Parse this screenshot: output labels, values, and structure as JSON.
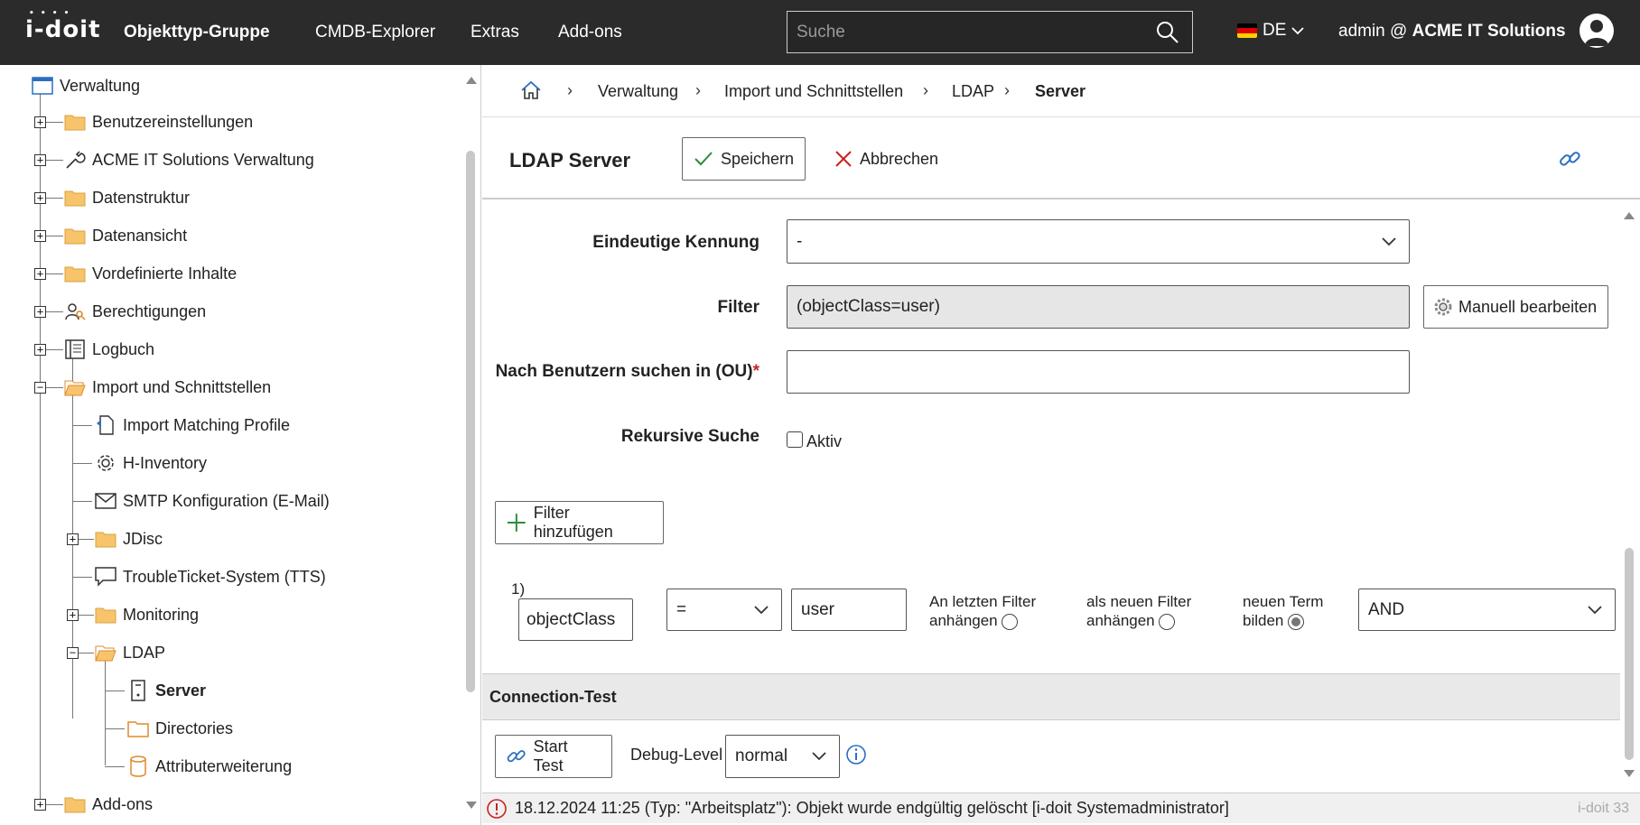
{
  "topbar": {
    "logo": "i-doit",
    "nav": [
      "Objekttyp-Gruppe",
      "CMDB-Explorer",
      "Extras",
      "Add-ons"
    ],
    "search_placeholder": "Suche",
    "language": "DE",
    "user_prefix": "admin @",
    "tenant": "ACME IT Solutions"
  },
  "tree": {
    "root": "Verwaltung",
    "items": [
      {
        "label": "Benutzereinstellungen",
        "icon": "folder-icon"
      },
      {
        "label": "ACME IT Solutions Verwaltung",
        "icon": "wrench-icon"
      },
      {
        "label": "Datenstruktur",
        "icon": "folder-icon"
      },
      {
        "label": "Datenansicht",
        "icon": "folder-icon"
      },
      {
        "label": "Vordefinierte Inhalte",
        "icon": "folder-icon"
      },
      {
        "label": "Berechtigungen",
        "icon": "users-icon"
      },
      {
        "label": "Logbuch",
        "icon": "book-icon"
      },
      {
        "label": "Import und Schnittstellen",
        "icon": "folder-open-icon"
      },
      {
        "label": "Import Matching Profile",
        "icon": "document-icon"
      },
      {
        "label": "H-Inventory",
        "icon": "gear-icon"
      },
      {
        "label": "SMTP Konfiguration (E-Mail)",
        "icon": "mail-icon"
      },
      {
        "label": "JDisc",
        "icon": "folder-icon"
      },
      {
        "label": "TroubleTicket-System (TTS)",
        "icon": "speech-bubble-icon"
      },
      {
        "label": "Monitoring",
        "icon": "folder-icon"
      },
      {
        "label": "LDAP",
        "icon": "folder-open-icon"
      },
      {
        "label": "Server",
        "icon": "server-icon"
      },
      {
        "label": "Directories",
        "icon": "folder-outline-icon"
      },
      {
        "label": "Attributerweiterung",
        "icon": "database-icon"
      },
      {
        "label": "Add-ons",
        "icon": "folder-icon"
      }
    ]
  },
  "breadcrumb": [
    "Verwaltung",
    "Import und Schnittstellen",
    "LDAP",
    "Server"
  ],
  "toolbar": {
    "title": "LDAP Server",
    "save_label": "Speichern",
    "cancel_label": "Abbrechen"
  },
  "form": {
    "unique_id_label": "Eindeutige Kennung",
    "unique_id_value": "-",
    "filter_label": "Filter",
    "filter_value": "(objectClass=user)",
    "manual_edit_label": "Manuell bearbeiten",
    "ou_label": "Nach Benutzern suchen in (OU)",
    "required_mark": "*",
    "ou_value": "",
    "recursive_label": "Rekursive Suche",
    "recursive_option": "Aktiv",
    "add_filter_label": "Filter hinzufügen"
  },
  "filter_row": {
    "index": "1)",
    "attribute": "objectClass",
    "operator": "=",
    "value": "user",
    "opt1_line1": "An letzten Filter",
    "opt1_line2": "anhängen",
    "opt2_line1": "als neuen Filter",
    "opt2_line2": "anhängen",
    "opt3_line1": "neuen Term",
    "opt3_line2": "bilden",
    "selected_option": "neuen Term bilden",
    "logic": "AND"
  },
  "connection": {
    "header": "Connection-Test",
    "start_label": "Start Test",
    "debug_label": "Debug-Level",
    "debug_value": "normal"
  },
  "status": {
    "message": "18.12.2024 11:25 (Typ: \"Arbeitsplatz\"): Objekt wurde endgültig gelöscht [i-doit Systemadministrator]",
    "version": "i-doit 33"
  },
  "colors": {
    "topbar": "#2b2b2b",
    "folder": "#f7c46b",
    "accent_blue": "#2a6fbf",
    "save_check": "#2e8b3a",
    "cancel_x": "#cc2222",
    "required": "#cc2222"
  }
}
